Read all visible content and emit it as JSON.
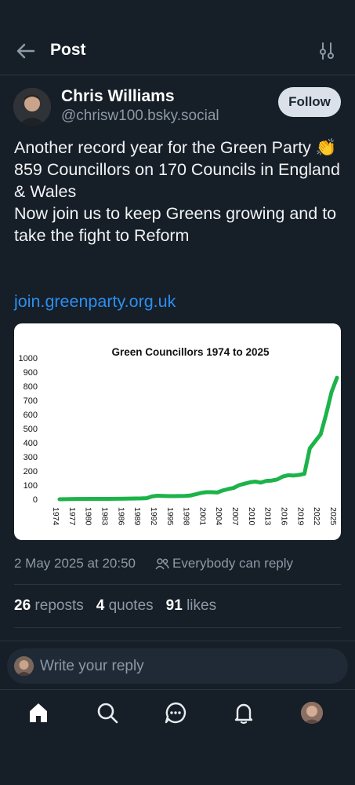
{
  "header": {
    "title": "Post",
    "back_icon": "arrow-left-icon",
    "filter_icon": "sliders-icon"
  },
  "author": {
    "name": "Chris Williams",
    "handle": "@chrisw100.bsky.social",
    "follow_label": "Follow"
  },
  "post": {
    "text_lines": [
      "Another record year for the Green Party 👏",
      "859 Councillors on 170 Councils in England & Wales",
      "",
      "Now join us to keep Greens growing and to take the fight to Reform"
    ],
    "link": "join.greenparty.org.uk",
    "timestamp": "2 May 2025 at 20:50",
    "reply_setting": "Everybody can reply"
  },
  "stats": {
    "reposts_count": "26",
    "reposts_label": "reposts",
    "quotes_count": "4",
    "quotes_label": "quotes",
    "likes_count": "91",
    "likes_label": "likes"
  },
  "reply": {
    "placeholder": "Write your reply"
  },
  "nav": {
    "items": [
      "home-icon",
      "search-icon",
      "chat-icon",
      "bell-icon",
      "profile-avatar"
    ]
  },
  "colors": {
    "accent_link": "#2b8ff0",
    "line_green": "#1db34a",
    "background": "#161e27"
  },
  "chart_data": {
    "type": "line",
    "title": "Green Councillors 1974 to 2025",
    "ylim": [
      0,
      1000
    ],
    "yticks": [
      0,
      100,
      200,
      300,
      400,
      500,
      600,
      700,
      800,
      900,
      1000
    ],
    "xticks": [
      "1974",
      "1977",
      "1980",
      "1983",
      "1986",
      "1989",
      "1992",
      "1995",
      "1998",
      "2001",
      "2004",
      "2007",
      "2010",
      "2013",
      "2016",
      "2019",
      "2022",
      "2025"
    ],
    "series": [
      {
        "x": [
          1974,
          1977,
          1980,
          1983,
          1986,
          1989,
          1990,
          1991,
          1992,
          1993,
          1994,
          1995,
          1996,
          1997,
          1998,
          1999,
          2000,
          2001,
          2002,
          2003,
          2004,
          2005,
          2006,
          2007,
          2008,
          2009,
          2010,
          2011,
          2012,
          2013,
          2014,
          2015,
          2016,
          2017,
          2018,
          2019,
          2020,
          2021,
          2022,
          2023,
          2024,
          2025
        ],
        "y": [
          0,
          2,
          3,
          3,
          4,
          6,
          8,
          20,
          25,
          24,
          22,
          22,
          23,
          24,
          26,
          35,
          45,
          50,
          50,
          48,
          62,
          72,
          80,
          100,
          110,
          120,
          125,
          118,
          130,
          132,
          140,
          160,
          170,
          168,
          172,
          180,
          360,
          410,
          460,
          600,
          760,
          860
        ]
      }
    ]
  }
}
